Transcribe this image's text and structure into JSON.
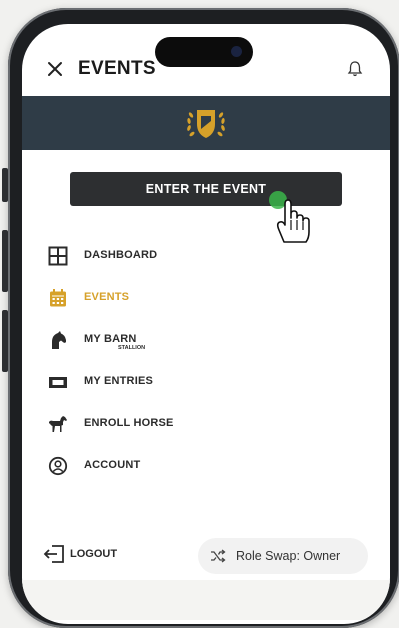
{
  "header": {
    "title": "EVENTS"
  },
  "cta": {
    "label": "ENTER THE EVENT"
  },
  "menu": {
    "items": [
      {
        "label": "DASHBOARD",
        "icon": "grid-icon",
        "active": false
      },
      {
        "label": "EVENTS",
        "icon": "calendar-icon",
        "active": true
      },
      {
        "label": "MY BARN",
        "icon": "horse-head-icon",
        "active": false,
        "badge": "STALLION"
      },
      {
        "label": "MY ENTRIES",
        "icon": "ticket-icon",
        "active": false
      },
      {
        "label": "ENROLL HORSE",
        "icon": "horse-icon",
        "active": false
      },
      {
        "label": "ACCOUNT",
        "icon": "user-circle-icon",
        "active": false
      }
    ]
  },
  "footer": {
    "logout_label": "LOGOUT",
    "role_swap_label": "Role Swap: Owner"
  },
  "colors": {
    "brand_bar": "#2f3c47",
    "accent_gold": "#d6a12a",
    "button_dark": "#2d2f31",
    "cursor_green": "#3bb54a"
  }
}
